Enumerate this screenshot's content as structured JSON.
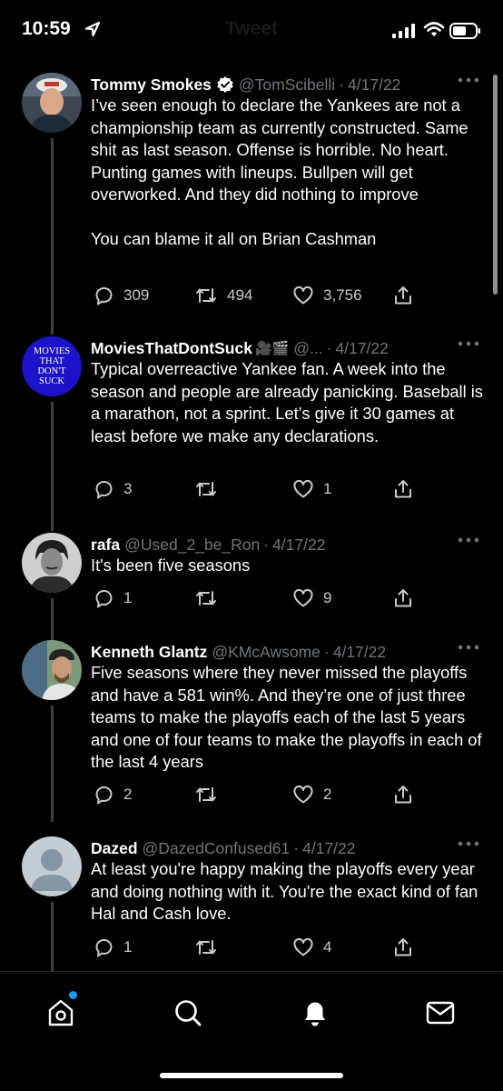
{
  "status_bar": {
    "time": "10:59"
  },
  "header": {
    "title": "Tweet"
  },
  "tweets": [
    {
      "name": "Tommy Smokes",
      "handle": "@TomScibelli",
      "date": "4/17/22",
      "text": "I’ve seen enough to declare the Yankees are not a championship team as currently constructed. Same shit as last season. Offense is horrible. No heart. Punting games with lineups. Bullpen will get overworked. And they did nothing to improve\n\nYou can blame it all on Brian Cashman",
      "replies": "309",
      "retweets": "494",
      "likes": "3,756",
      "verified": true
    },
    {
      "name": "MoviesThatDontSuck",
      "handle": "@...",
      "date": "4/17/22",
      "avatar_text": "MOVIES THAT DON'T SUCK",
      "text": "Typical overreactive Yankee fan. A week into the season and people are already panicking. Baseball is a marathon, not a sprint. Let’s give it 30 games at least before we make any declarations.",
      "replies": "3",
      "retweets": "",
      "likes": "1",
      "emoji": "🎥🎬"
    },
    {
      "name": "rafa",
      "handle": "@Used_2_be_Ron",
      "date": "4/17/22",
      "text": "It's been five seasons",
      "replies": "1",
      "retweets": "",
      "likes": "9"
    },
    {
      "name": "Kenneth Glantz",
      "handle": "@KMcAwsome",
      "date": "4/17/22",
      "text": "Five seasons where they never missed the playoffs and have a 581 win%. And they’re one of just three teams to make the playoffs each of the last 5 years and one of four teams to make the playoffs in each of the last 4 years",
      "replies": "2",
      "retweets": "",
      "likes": "2"
    },
    {
      "name": "Dazed",
      "handle": "@DazedConfused61",
      "date": "4/17/22",
      "text": "At least you're happy making the playoffs every year and doing nothing with it. You're the exact kind of fan Hal and Cash love.",
      "replies": "1",
      "retweets": "",
      "likes": "4"
    }
  ],
  "separator": "·",
  "tabs": [
    "home-icon",
    "search-icon",
    "notifications-icon",
    "messages-icon"
  ],
  "colors": {
    "accent": "#1d9bf0",
    "muted": "#71767b",
    "background": "#000000"
  }
}
